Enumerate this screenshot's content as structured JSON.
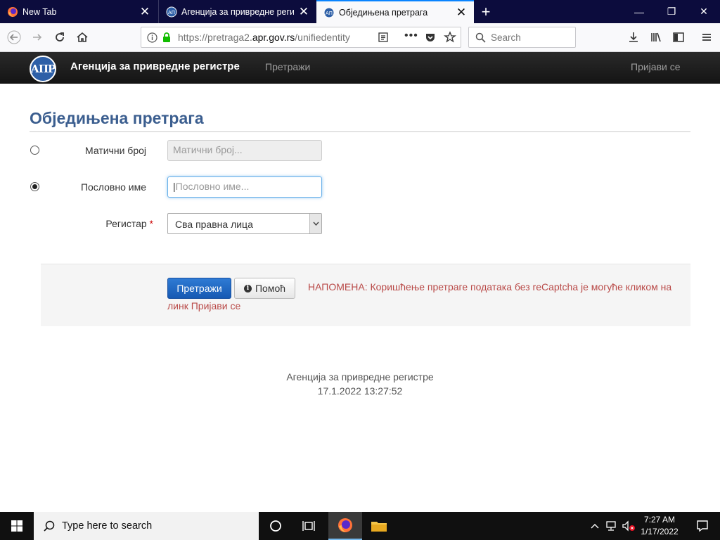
{
  "browser": {
    "tabs": [
      {
        "title": "New Tab"
      },
      {
        "title": "Агенција за привредне регистре"
      },
      {
        "title": "Обједињена претрага"
      }
    ],
    "url_host": "https://pretraga2.",
    "url_domain": "apr.gov.rs",
    "url_path": "/unifiedentity",
    "search_placeholder": "Search"
  },
  "site": {
    "logo_text": "АПР",
    "brand": "Агенција за привредне регистре",
    "nav_search": "Претражи",
    "nav_login": "Пријави се"
  },
  "form": {
    "heading": "Обједињена претрага",
    "reg_number_label": "Матични број",
    "reg_number_placeholder": "Матични број...",
    "business_name_label": "Пословно име",
    "business_name_placeholder": "Пословно име...",
    "register_label": "Регистар",
    "register_required_mark": "*",
    "register_value": "Сва правна лица",
    "search_button": "Претражи",
    "help_button": "Помоћ",
    "note_line1": "НАПОМЕНА: Коришћење претраге података без reCaptcha је могуће кликом на",
    "note_line2": "линк Пријави се"
  },
  "footer": {
    "name": "Агенција за привредне регистре",
    "datetime": "17.1.2022 13:27:52"
  },
  "taskbar": {
    "search_placeholder": "Type here to search",
    "time": "7:27 AM",
    "date": "1/17/2022"
  }
}
